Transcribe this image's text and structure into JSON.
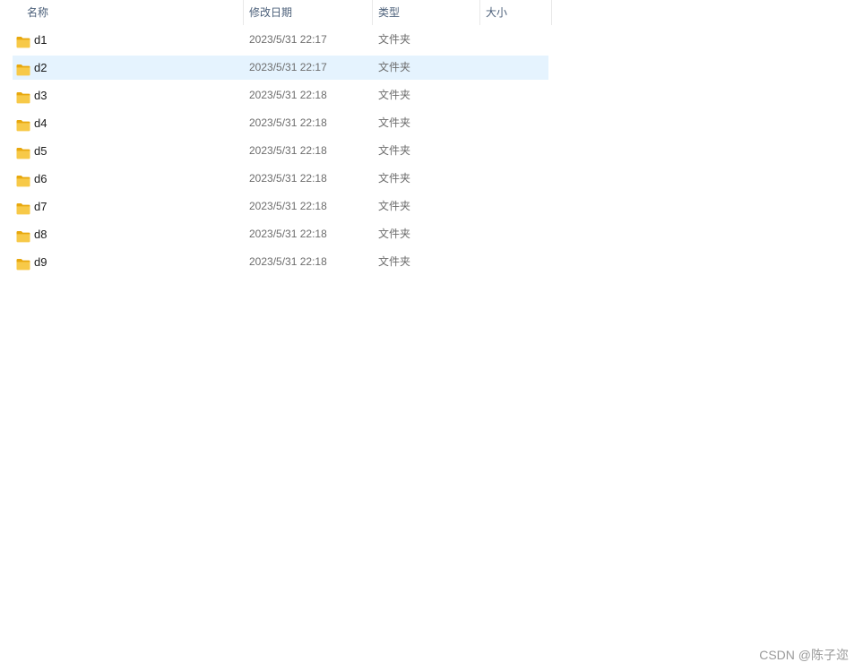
{
  "columns": {
    "name": "名称",
    "date": "修改日期",
    "type": "类型",
    "size": "大小"
  },
  "sort_indicator": "^",
  "rows": [
    {
      "name": "d1",
      "date": "2023/5/31 22:17",
      "type": "文件夹",
      "size": "",
      "selected": false,
      "icon": "folder-icon"
    },
    {
      "name": "d2",
      "date": "2023/5/31 22:17",
      "type": "文件夹",
      "size": "",
      "selected": true,
      "icon": "folder-icon"
    },
    {
      "name": "d3",
      "date": "2023/5/31 22:18",
      "type": "文件夹",
      "size": "",
      "selected": false,
      "icon": "folder-icon"
    },
    {
      "name": "d4",
      "date": "2023/5/31 22:18",
      "type": "文件夹",
      "size": "",
      "selected": false,
      "icon": "folder-icon"
    },
    {
      "name": "d5",
      "date": "2023/5/31 22:18",
      "type": "文件夹",
      "size": "",
      "selected": false,
      "icon": "folder-icon"
    },
    {
      "name": "d6",
      "date": "2023/5/31 22:18",
      "type": "文件夹",
      "size": "",
      "selected": false,
      "icon": "folder-icon"
    },
    {
      "name": "d7",
      "date": "2023/5/31 22:18",
      "type": "文件夹",
      "size": "",
      "selected": false,
      "icon": "folder-icon"
    },
    {
      "name": "d8",
      "date": "2023/5/31 22:18",
      "type": "文件夹",
      "size": "",
      "selected": false,
      "icon": "folder-icon"
    },
    {
      "name": "d9",
      "date": "2023/5/31 22:18",
      "type": "文件夹",
      "size": "",
      "selected": false,
      "icon": "folder-icon"
    }
  ],
  "watermark": "CSDN @陈子迩",
  "colors": {
    "selected_row": "#e5f3fe",
    "folder_body": "#f7c948",
    "folder_tab": "#e8a80e",
    "header_text": "#4c607a"
  }
}
